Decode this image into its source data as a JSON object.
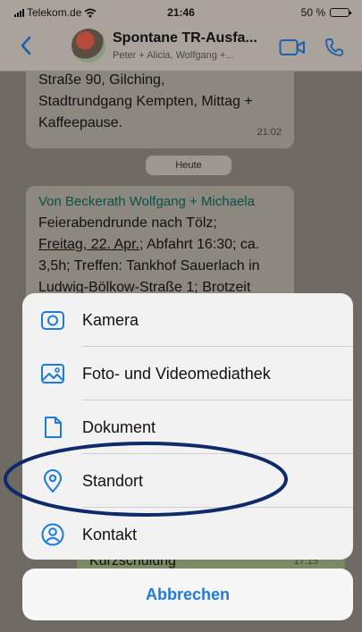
{
  "status_bar": {
    "carrier": "Telekom.de",
    "time": "21:46",
    "battery": "50 %",
    "battery_level": 0.5
  },
  "header": {
    "title": "Spontane TR-Ausfa...",
    "subtitle": "Peter + Alicia, Wolfgang +..."
  },
  "chat": {
    "message1_lines": [
      "Straße 90, Gilching,",
      "Stadtrundgang Kempten, Mittag +",
      "Kaffeepause."
    ],
    "message1_time": "21:02",
    "day_separator": "Heute",
    "message2_sender": "Von Beckerath Wolfgang + Michaela",
    "message2_line1": "Feierabendrunde nach Tölz;",
    "message2_line2_link": "Freitag, 22. Apr.",
    "message2_line2_rest": "; Abfahrt 16:30; ca.",
    "message2_line3": "3,5h; Treffen: Tankhof Sauerlach in",
    "message2_line4": "Ludwig-Bölkow-Straße 1; Brotzeit",
    "message3_text": "Kurzschulung",
    "message3_time": "17:15"
  },
  "action_sheet": {
    "options": [
      {
        "label": "Kamera",
        "icon": "camera-icon"
      },
      {
        "label": "Foto- und Videomediathek",
        "icon": "photo-library-icon"
      },
      {
        "label": "Dokument",
        "icon": "document-icon"
      },
      {
        "label": "Standort",
        "icon": "location-pin-icon"
      },
      {
        "label": "Kontakt",
        "icon": "contact-icon"
      }
    ],
    "cancel": "Abbrechen"
  },
  "colors": {
    "accent": "#1f7ae0",
    "highlight": "#0e2a6b"
  }
}
